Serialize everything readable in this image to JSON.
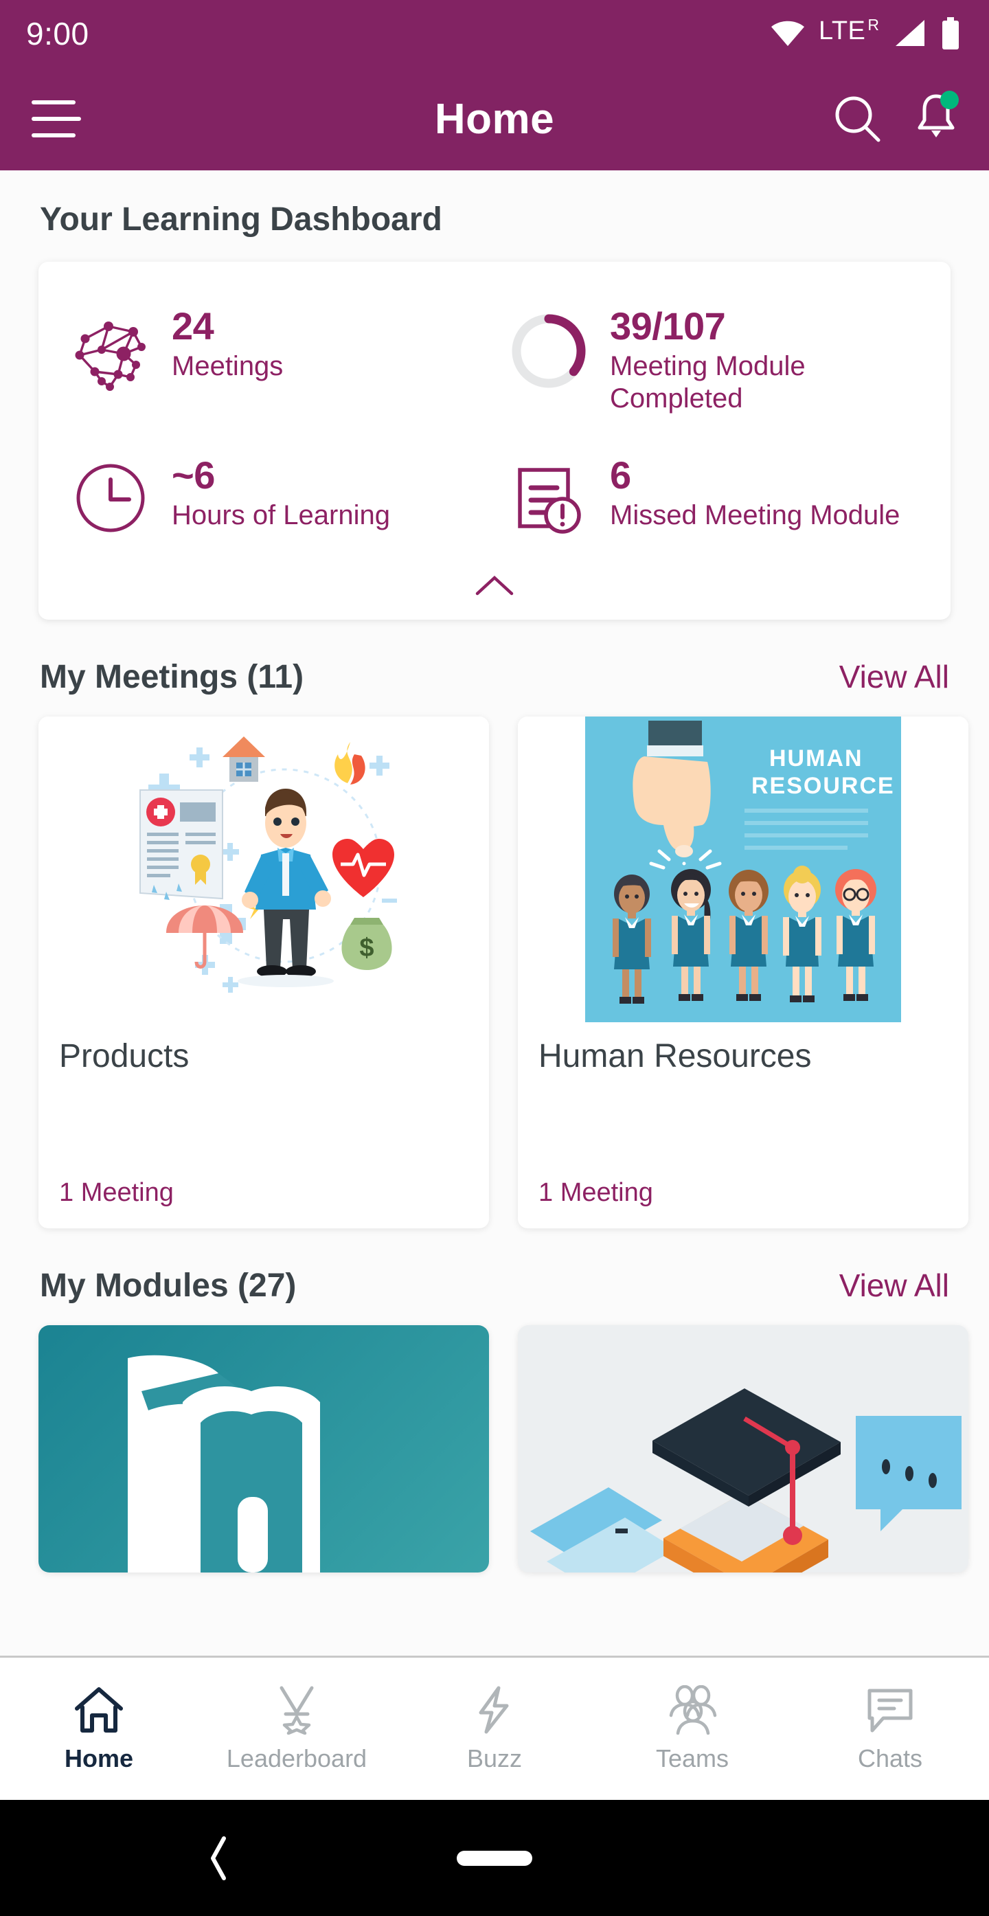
{
  "status_bar": {
    "time": "9:00",
    "network_label": "LTE",
    "roaming_label": "R",
    "icons": [
      "wifi-icon",
      "signal-icon",
      "battery-icon"
    ]
  },
  "app_bar": {
    "title": "Home",
    "menu_icon": "hamburger-menu-icon",
    "search_icon": "search-icon",
    "notifications_icon": "bell-icon",
    "notification_badge": true
  },
  "dashboard": {
    "heading": "Your Learning Dashboard",
    "collapse_icon": "chevron-up-icon",
    "stats": [
      {
        "icon": "network-graph-icon",
        "value": "24",
        "label": "Meetings"
      },
      {
        "icon": "progress-ring-icon",
        "value": "39/107",
        "label": "Meeting Module Completed",
        "progress_completed": 39,
        "progress_total": 107,
        "progress_percent": 36
      },
      {
        "icon": "clock-icon",
        "value": "~6",
        "label": "Hours of Learning"
      },
      {
        "icon": "document-alert-icon",
        "value": "6",
        "label": "Missed Meeting Module"
      }
    ]
  },
  "meetings_section": {
    "title": "My Meetings (11)",
    "view_all": "View All",
    "cards": [
      {
        "title": "Products",
        "subtitle": "1 Meeting",
        "image": "insurance-illustration"
      },
      {
        "title": "Human Resources",
        "subtitle": "1 Meeting",
        "image": "human-resource-illustration",
        "image_heading_line1": "HUMAN",
        "image_heading_line2": "RESOURCE"
      }
    ]
  },
  "modules_section": {
    "title": "My Modules (27)",
    "view_all": "View All",
    "cards": [
      {
        "image": "shield-lock-illustration",
        "background": "#1b8392"
      },
      {
        "image": "graduation-cap-illustration",
        "background": "#eceff1"
      }
    ]
  },
  "bottom_nav": {
    "items": [
      {
        "label": "Home",
        "icon": "home-icon",
        "active": true
      },
      {
        "label": "Leaderboard",
        "icon": "medal-icon",
        "active": false
      },
      {
        "label": "Buzz",
        "icon": "lightning-bolt-icon",
        "active": false
      },
      {
        "label": "Teams",
        "icon": "people-group-icon",
        "active": false
      },
      {
        "label": "Chats",
        "icon": "chat-bubble-icon",
        "active": false
      }
    ]
  },
  "android_nav": {
    "back_icon": "back-chevron-icon",
    "home_icon": "home-pill-icon"
  },
  "colors": {
    "brand_purple": "#822363",
    "accent_magenta": "#8d2163",
    "heading_dark": "#3b4348",
    "badge_green": "#00b87c",
    "nav_inactive": "#9ea4a8",
    "nav_active": "#16283f",
    "module_teal": "#1b8392"
  }
}
